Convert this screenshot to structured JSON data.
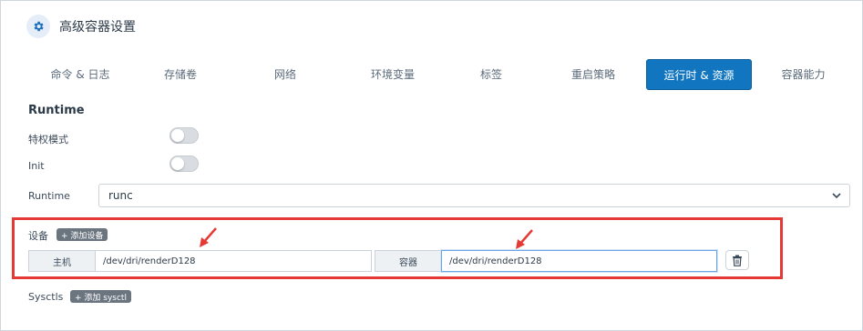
{
  "header": {
    "title": "高级容器设置",
    "icon": "gear-icon"
  },
  "tabs": [
    {
      "label": "命令 & 日志",
      "active": false
    },
    {
      "label": "存储卷",
      "active": false
    },
    {
      "label": "网络",
      "active": false
    },
    {
      "label": "环境变量",
      "active": false
    },
    {
      "label": "标签",
      "active": false
    },
    {
      "label": "重启策略",
      "active": false
    },
    {
      "label": "运行时 & 资源",
      "active": true
    },
    {
      "label": "容器能力",
      "active": false
    }
  ],
  "runtime": {
    "section_title": "Runtime",
    "privileged_label": "特权模式",
    "privileged_on": false,
    "init_label": "Init",
    "init_on": false,
    "runtime_label": "Runtime",
    "runtime_value": "runc"
  },
  "devices": {
    "label": "设备",
    "add_button": "+ 添加设备",
    "host_label": "主机",
    "host_value": "/dev/dri/renderD128",
    "container_label": "容器",
    "container_value": "/dev/dri/renderD128"
  },
  "sysctls": {
    "label": "Sysctls",
    "add_button": "+ 添加 sysctl"
  },
  "colors": {
    "accent": "#1176bf",
    "highlight_box": "#e53935"
  }
}
